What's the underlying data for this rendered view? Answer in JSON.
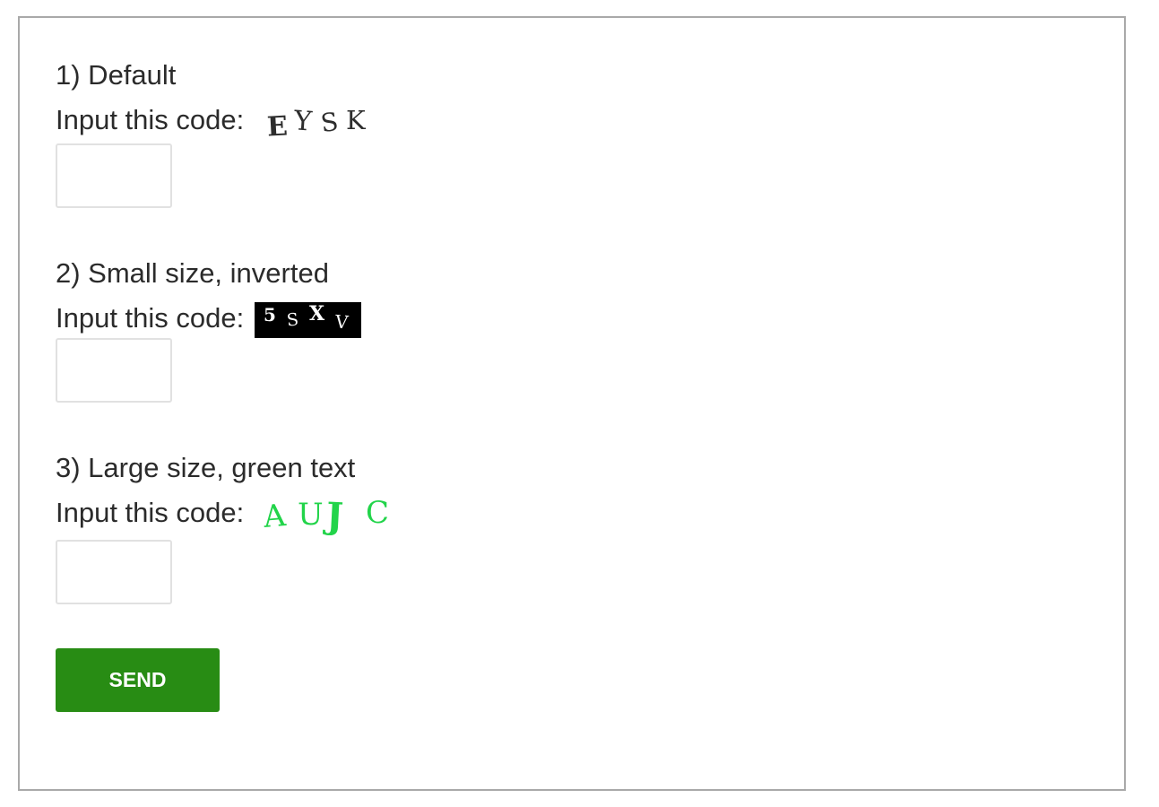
{
  "form": {
    "sections": [
      {
        "heading": "1) Default",
        "code_label": "Input this code:",
        "captcha_chars": [
          "E",
          "Y",
          "S",
          "K"
        ],
        "captcha_style": "default",
        "input_value": ""
      },
      {
        "heading": "2) Small size, inverted",
        "code_label": "Input this code:",
        "captcha_chars": [
          "5",
          "S",
          "X",
          "V"
        ],
        "captcha_style": "inverted",
        "input_value": ""
      },
      {
        "heading": "3) Large size, green text",
        "code_label": "Input this code:",
        "captcha_chars": [
          "A",
          "U",
          "J",
          "C"
        ],
        "captcha_style": "green",
        "input_value": ""
      }
    ],
    "send_label": "SEND"
  },
  "colors": {
    "send_button": "#288c14",
    "captcha_green": "#22d44a",
    "captcha_inverted_bg": "#000000"
  }
}
